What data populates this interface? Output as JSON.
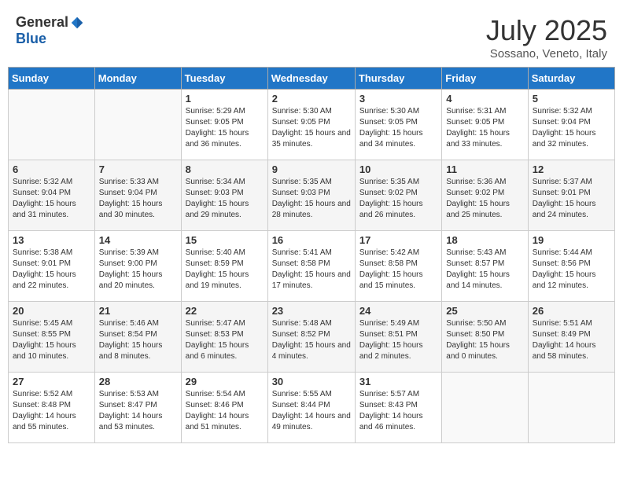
{
  "logo": {
    "general": "General",
    "blue": "Blue"
  },
  "header": {
    "month": "July 2025",
    "location": "Sossano, Veneto, Italy"
  },
  "weekdays": [
    "Sunday",
    "Monday",
    "Tuesday",
    "Wednesday",
    "Thursday",
    "Friday",
    "Saturday"
  ],
  "weeks": [
    [
      null,
      null,
      {
        "day": 1,
        "sunrise": "5:29 AM",
        "sunset": "9:05 PM",
        "daylight": "15 hours and 36 minutes."
      },
      {
        "day": 2,
        "sunrise": "5:30 AM",
        "sunset": "9:05 PM",
        "daylight": "15 hours and 35 minutes."
      },
      {
        "day": 3,
        "sunrise": "5:30 AM",
        "sunset": "9:05 PM",
        "daylight": "15 hours and 34 minutes."
      },
      {
        "day": 4,
        "sunrise": "5:31 AM",
        "sunset": "9:05 PM",
        "daylight": "15 hours and 33 minutes."
      },
      {
        "day": 5,
        "sunrise": "5:32 AM",
        "sunset": "9:04 PM",
        "daylight": "15 hours and 32 minutes."
      }
    ],
    [
      {
        "day": 6,
        "sunrise": "5:32 AM",
        "sunset": "9:04 PM",
        "daylight": "15 hours and 31 minutes."
      },
      {
        "day": 7,
        "sunrise": "5:33 AM",
        "sunset": "9:04 PM",
        "daylight": "15 hours and 30 minutes."
      },
      {
        "day": 8,
        "sunrise": "5:34 AM",
        "sunset": "9:03 PM",
        "daylight": "15 hours and 29 minutes."
      },
      {
        "day": 9,
        "sunrise": "5:35 AM",
        "sunset": "9:03 PM",
        "daylight": "15 hours and 28 minutes."
      },
      {
        "day": 10,
        "sunrise": "5:35 AM",
        "sunset": "9:02 PM",
        "daylight": "15 hours and 26 minutes."
      },
      {
        "day": 11,
        "sunrise": "5:36 AM",
        "sunset": "9:02 PM",
        "daylight": "15 hours and 25 minutes."
      },
      {
        "day": 12,
        "sunrise": "5:37 AM",
        "sunset": "9:01 PM",
        "daylight": "15 hours and 24 minutes."
      }
    ],
    [
      {
        "day": 13,
        "sunrise": "5:38 AM",
        "sunset": "9:01 PM",
        "daylight": "15 hours and 22 minutes."
      },
      {
        "day": 14,
        "sunrise": "5:39 AM",
        "sunset": "9:00 PM",
        "daylight": "15 hours and 20 minutes."
      },
      {
        "day": 15,
        "sunrise": "5:40 AM",
        "sunset": "8:59 PM",
        "daylight": "15 hours and 19 minutes."
      },
      {
        "day": 16,
        "sunrise": "5:41 AM",
        "sunset": "8:58 PM",
        "daylight": "15 hours and 17 minutes."
      },
      {
        "day": 17,
        "sunrise": "5:42 AM",
        "sunset": "8:58 PM",
        "daylight": "15 hours and 15 minutes."
      },
      {
        "day": 18,
        "sunrise": "5:43 AM",
        "sunset": "8:57 PM",
        "daylight": "15 hours and 14 minutes."
      },
      {
        "day": 19,
        "sunrise": "5:44 AM",
        "sunset": "8:56 PM",
        "daylight": "15 hours and 12 minutes."
      }
    ],
    [
      {
        "day": 20,
        "sunrise": "5:45 AM",
        "sunset": "8:55 PM",
        "daylight": "15 hours and 10 minutes."
      },
      {
        "day": 21,
        "sunrise": "5:46 AM",
        "sunset": "8:54 PM",
        "daylight": "15 hours and 8 minutes."
      },
      {
        "day": 22,
        "sunrise": "5:47 AM",
        "sunset": "8:53 PM",
        "daylight": "15 hours and 6 minutes."
      },
      {
        "day": 23,
        "sunrise": "5:48 AM",
        "sunset": "8:52 PM",
        "daylight": "15 hours and 4 minutes."
      },
      {
        "day": 24,
        "sunrise": "5:49 AM",
        "sunset": "8:51 PM",
        "daylight": "15 hours and 2 minutes."
      },
      {
        "day": 25,
        "sunrise": "5:50 AM",
        "sunset": "8:50 PM",
        "daylight": "15 hours and 0 minutes."
      },
      {
        "day": 26,
        "sunrise": "5:51 AM",
        "sunset": "8:49 PM",
        "daylight": "14 hours and 58 minutes."
      }
    ],
    [
      {
        "day": 27,
        "sunrise": "5:52 AM",
        "sunset": "8:48 PM",
        "daylight": "14 hours and 55 minutes."
      },
      {
        "day": 28,
        "sunrise": "5:53 AM",
        "sunset": "8:47 PM",
        "daylight": "14 hours and 53 minutes."
      },
      {
        "day": 29,
        "sunrise": "5:54 AM",
        "sunset": "8:46 PM",
        "daylight": "14 hours and 51 minutes."
      },
      {
        "day": 30,
        "sunrise": "5:55 AM",
        "sunset": "8:44 PM",
        "daylight": "14 hours and 49 minutes."
      },
      {
        "day": 31,
        "sunrise": "5:57 AM",
        "sunset": "8:43 PM",
        "daylight": "14 hours and 46 minutes."
      },
      null,
      null
    ]
  ],
  "labels": {
    "sunrise": "Sunrise:",
    "sunset": "Sunset:",
    "daylight": "Daylight:"
  }
}
